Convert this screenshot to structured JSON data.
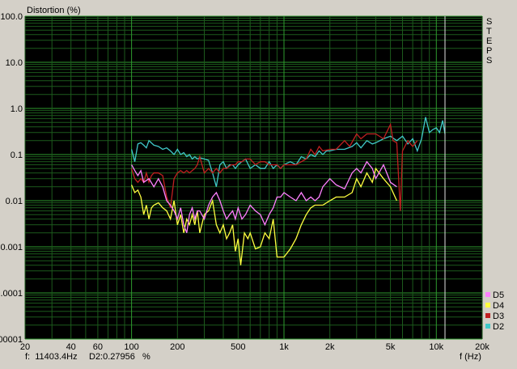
{
  "chart_data": {
    "type": "line",
    "title": "",
    "ylabel": "Distortion (%)",
    "xlabel": "f (Hz)",
    "xscale": "log",
    "yscale": "log",
    "xlim": [
      20,
      20000
    ],
    "ylim": [
      1e-05,
      100
    ],
    "grid": true,
    "background": "#000000",
    "x_ticks": [
      {
        "v": 20,
        "label": "20"
      },
      {
        "v": 40,
        "label": "40"
      },
      {
        "v": 60,
        "label": "60"
      },
      {
        "v": 100,
        "label": "100"
      },
      {
        "v": 200,
        "label": "200"
      },
      {
        "v": 500,
        "label": "500"
      },
      {
        "v": 1000,
        "label": "1k"
      },
      {
        "v": 2000,
        "label": "2k"
      },
      {
        "v": 5000,
        "label": "5k"
      },
      {
        "v": 10000,
        "label": "10k"
      },
      {
        "v": 20000,
        "label": "20k"
      }
    ],
    "y_ticks": [
      {
        "v": 100,
        "label": "100.0"
      },
      {
        "v": 10,
        "label": "10.0"
      },
      {
        "v": 1,
        "label": "1.0"
      },
      {
        "v": 0.1,
        "label": "0.1"
      },
      {
        "v": 0.01,
        "label": "0.01"
      },
      {
        "v": 0.001,
        "label": "0.001"
      },
      {
        "v": 0.0001,
        "label": "0.0001"
      },
      {
        "v": 1e-05,
        "label": "0.00001"
      }
    ],
    "cursor_x": 11403.4,
    "side_label": "STEPS",
    "legend_position": "bottom-right",
    "series": [
      {
        "name": "D2",
        "color": "#40c8c8",
        "points": [
          [
            100,
            0.13
          ],
          [
            105,
            0.07
          ],
          [
            110,
            0.17
          ],
          [
            115,
            0.18
          ],
          [
            120,
            0.16
          ],
          [
            125,
            0.14
          ],
          [
            130,
            0.2
          ],
          [
            140,
            0.16
          ],
          [
            150,
            0.15
          ],
          [
            160,
            0.13
          ],
          [
            170,
            0.14
          ],
          [
            180,
            0.12
          ],
          [
            190,
            0.1
          ],
          [
            200,
            0.13
          ],
          [
            210,
            0.1
          ],
          [
            220,
            0.11
          ],
          [
            230,
            0.09
          ],
          [
            240,
            0.1
          ],
          [
            250,
            0.08
          ],
          [
            260,
            0.09
          ],
          [
            270,
            0.08
          ],
          [
            280,
            0.085
          ],
          [
            300,
            0.08
          ],
          [
            320,
            0.075
          ],
          [
            340,
            0.04
          ],
          [
            360,
            0.02
          ],
          [
            380,
            0.06
          ],
          [
            400,
            0.07
          ],
          [
            420,
            0.05
          ],
          [
            440,
            0.06
          ],
          [
            460,
            0.06
          ],
          [
            480,
            0.05
          ],
          [
            500,
            0.06
          ],
          [
            530,
            0.07
          ],
          [
            560,
            0.08
          ],
          [
            600,
            0.05
          ],
          [
            650,
            0.06
          ],
          [
            700,
            0.05
          ],
          [
            750,
            0.05
          ],
          [
            800,
            0.07
          ],
          [
            850,
            0.05
          ],
          [
            900,
            0.06
          ],
          [
            950,
            0.05
          ],
          [
            1000,
            0.06
          ],
          [
            1100,
            0.07
          ],
          [
            1200,
            0.06
          ],
          [
            1300,
            0.09
          ],
          [
            1400,
            0.08
          ],
          [
            1500,
            0.1
          ],
          [
            1600,
            0.09
          ],
          [
            1700,
            0.12
          ],
          [
            1800,
            0.1
          ],
          [
            1900,
            0.12
          ],
          [
            2000,
            0.12
          ],
          [
            2200,
            0.13
          ],
          [
            2500,
            0.13
          ],
          [
            2800,
            0.15
          ],
          [
            3000,
            0.18
          ],
          [
            3200,
            0.14
          ],
          [
            3500,
            0.2
          ],
          [
            3800,
            0.17
          ],
          [
            4000,
            0.18
          ],
          [
            4500,
            0.22
          ],
          [
            5000,
            0.25
          ],
          [
            5500,
            0.2
          ],
          [
            6000,
            0.25
          ],
          [
            6500,
            0.17
          ],
          [
            7000,
            0.22
          ],
          [
            7500,
            0.12
          ],
          [
            8000,
            0.22
          ],
          [
            8500,
            0.65
          ],
          [
            9000,
            0.3
          ],
          [
            9500,
            0.35
          ],
          [
            10000,
            0.38
          ],
          [
            10500,
            0.3
          ],
          [
            11000,
            0.55
          ],
          [
            11400,
            0.28
          ]
        ]
      },
      {
        "name": "D3",
        "color": "#c02020",
        "points": [
          [
            100,
            0.05
          ],
          [
            105,
            0.03
          ],
          [
            110,
            0.025
          ],
          [
            115,
            0.03
          ],
          [
            120,
            0.025
          ],
          [
            125,
            0.04
          ],
          [
            130,
            0.025
          ],
          [
            135,
            0.035
          ],
          [
            140,
            0.04
          ],
          [
            150,
            0.04
          ],
          [
            160,
            0.035
          ],
          [
            170,
            0.012
          ],
          [
            180,
            0.007
          ],
          [
            190,
            0.03
          ],
          [
            200,
            0.04
          ],
          [
            210,
            0.045
          ],
          [
            220,
            0.04
          ],
          [
            230,
            0.045
          ],
          [
            240,
            0.04
          ],
          [
            250,
            0.045
          ],
          [
            260,
            0.05
          ],
          [
            270,
            0.06
          ],
          [
            280,
            0.09
          ],
          [
            300,
            0.04
          ],
          [
            320,
            0.05
          ],
          [
            340,
            0.04
          ],
          [
            360,
            0.05
          ],
          [
            380,
            0.04
          ],
          [
            400,
            0.05
          ],
          [
            420,
            0.05
          ],
          [
            450,
            0.06
          ],
          [
            480,
            0.06
          ],
          [
            500,
            0.07
          ],
          [
            530,
            0.07
          ],
          [
            560,
            0.08
          ],
          [
            600,
            0.08
          ],
          [
            650,
            0.06
          ],
          [
            700,
            0.07
          ],
          [
            750,
            0.07
          ],
          [
            800,
            0.06
          ],
          [
            850,
            0.06
          ],
          [
            900,
            0.06
          ],
          [
            950,
            0.05
          ],
          [
            1000,
            0.06
          ],
          [
            1100,
            0.06
          ],
          [
            1200,
            0.06
          ],
          [
            1300,
            0.07
          ],
          [
            1400,
            0.08
          ],
          [
            1500,
            0.13
          ],
          [
            1600,
            0.1
          ],
          [
            1700,
            0.15
          ],
          [
            1800,
            0.12
          ],
          [
            2000,
            0.13
          ],
          [
            2200,
            0.13
          ],
          [
            2500,
            0.2
          ],
          [
            2700,
            0.15
          ],
          [
            3000,
            0.28
          ],
          [
            3200,
            0.22
          ],
          [
            3500,
            0.28
          ],
          [
            4000,
            0.28
          ],
          [
            4500,
            0.22
          ],
          [
            5000,
            0.45
          ],
          [
            5200,
            0.2
          ],
          [
            5500,
            0.18
          ],
          [
            5800,
            0.006
          ],
          [
            6000,
            0.12
          ],
          [
            6500,
            0.2
          ],
          [
            7000,
            0.15
          ],
          [
            7500,
            0.2
          ]
        ]
      },
      {
        "name": "D4",
        "color": "#ffff40",
        "points": [
          [
            100,
            0.022
          ],
          [
            105,
            0.015
          ],
          [
            110,
            0.017
          ],
          [
            115,
            0.012
          ],
          [
            120,
            0.005
          ],
          [
            125,
            0.008
          ],
          [
            130,
            0.004
          ],
          [
            135,
            0.007
          ],
          [
            140,
            0.008
          ],
          [
            150,
            0.009
          ],
          [
            160,
            0.007
          ],
          [
            170,
            0.006
          ],
          [
            180,
            0.004
          ],
          [
            190,
            0.01
          ],
          [
            200,
            0.003
          ],
          [
            210,
            0.005
          ],
          [
            220,
            0.002
          ],
          [
            230,
            0.004
          ],
          [
            240,
            0.003
          ],
          [
            250,
            0.005
          ],
          [
            260,
            0.003
          ],
          [
            270,
            0.006
          ],
          [
            280,
            0.002
          ],
          [
            300,
            0.005
          ],
          [
            320,
            0.006
          ],
          [
            340,
            0.01
          ],
          [
            360,
            0.003
          ],
          [
            380,
            0.002
          ],
          [
            400,
            0.003
          ],
          [
            420,
            0.0015
          ],
          [
            440,
            0.002
          ],
          [
            460,
            0.003
          ],
          [
            480,
            0.0008
          ],
          [
            500,
            0.0015
          ],
          [
            520,
            0.0004
          ],
          [
            550,
            0.002
          ],
          [
            580,
            0.0015
          ],
          [
            600,
            0.002
          ],
          [
            650,
            0.0009
          ],
          [
            700,
            0.001
          ],
          [
            750,
            0.002
          ],
          [
            800,
            0.0015
          ],
          [
            850,
            0.004
          ],
          [
            900,
            0.0006
          ],
          [
            950,
            0.0006
          ],
          [
            1000,
            0.0006
          ],
          [
            1100,
            0.0009
          ],
          [
            1200,
            0.0015
          ],
          [
            1300,
            0.003
          ],
          [
            1400,
            0.005
          ],
          [
            1500,
            0.007
          ],
          [
            1600,
            0.008
          ],
          [
            1700,
            0.008
          ],
          [
            1800,
            0.008
          ],
          [
            2000,
            0.01
          ],
          [
            2200,
            0.012
          ],
          [
            2500,
            0.012
          ],
          [
            2800,
            0.015
          ],
          [
            3000,
            0.03
          ],
          [
            3200,
            0.02
          ],
          [
            3500,
            0.04
          ],
          [
            3800,
            0.025
          ],
          [
            4000,
            0.05
          ],
          [
            4500,
            0.03
          ],
          [
            5000,
            0.02
          ],
          [
            5500,
            0.01
          ]
        ]
      },
      {
        "name": "D5",
        "color": "#ff80ff",
        "points": [
          [
            100,
            0.06
          ],
          [
            105,
            0.045
          ],
          [
            110,
            0.035
          ],
          [
            115,
            0.045
          ],
          [
            120,
            0.025
          ],
          [
            130,
            0.03
          ],
          [
            140,
            0.02
          ],
          [
            150,
            0.03
          ],
          [
            160,
            0.02
          ],
          [
            170,
            0.01
          ],
          [
            180,
            0.008
          ],
          [
            190,
            0.006
          ],
          [
            200,
            0.004
          ],
          [
            210,
            0.007
          ],
          [
            220,
            0.003
          ],
          [
            230,
            0.002
          ],
          [
            240,
            0.005
          ],
          [
            250,
            0.007
          ],
          [
            260,
            0.004
          ],
          [
            270,
            0.006
          ],
          [
            280,
            0.006
          ],
          [
            300,
            0.004
          ],
          [
            320,
            0.008
          ],
          [
            340,
            0.012
          ],
          [
            360,
            0.015
          ],
          [
            380,
            0.01
          ],
          [
            400,
            0.006
          ],
          [
            420,
            0.004
          ],
          [
            440,
            0.005
          ],
          [
            460,
            0.006
          ],
          [
            480,
            0.004
          ],
          [
            500,
            0.007
          ],
          [
            530,
            0.004
          ],
          [
            560,
            0.005
          ],
          [
            600,
            0.008
          ],
          [
            650,
            0.006
          ],
          [
            700,
            0.005
          ],
          [
            750,
            0.003
          ],
          [
            800,
            0.005
          ],
          [
            850,
            0.007
          ],
          [
            900,
            0.012
          ],
          [
            950,
            0.012
          ],
          [
            1000,
            0.015
          ],
          [
            1100,
            0.012
          ],
          [
            1200,
            0.01
          ],
          [
            1300,
            0.015
          ],
          [
            1400,
            0.01
          ],
          [
            1500,
            0.012
          ],
          [
            1600,
            0.01
          ],
          [
            1700,
            0.012
          ],
          [
            1800,
            0.02
          ],
          [
            2000,
            0.03
          ],
          [
            2200,
            0.022
          ],
          [
            2500,
            0.018
          ],
          [
            2800,
            0.04
          ],
          [
            3000,
            0.05
          ],
          [
            3200,
            0.04
          ],
          [
            3500,
            0.07
          ],
          [
            3800,
            0.05
          ],
          [
            4000,
            0.03
          ],
          [
            4500,
            0.06
          ],
          [
            5000,
            0.025
          ],
          [
            5500,
            0.02
          ]
        ]
      }
    ]
  },
  "status": {
    "freq_readout": "f:  11403.4Hz",
    "dist_readout": "D2:0.27956",
    "unit": "%"
  }
}
